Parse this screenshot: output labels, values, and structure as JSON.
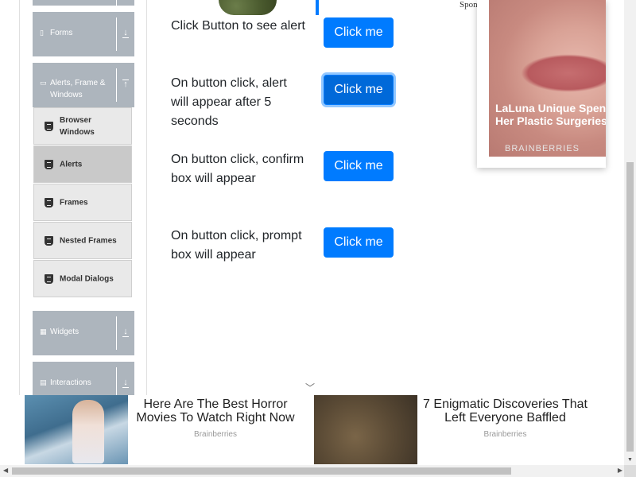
{
  "sidebar": {
    "groups": [
      {
        "label": "Forms",
        "icon": "form-icon",
        "arrow": "expand"
      },
      {
        "label": "Alerts, Frame & Windows",
        "icon": "window-icon",
        "arrow": "collapse"
      },
      {
        "label": "Widgets",
        "icon": "widgets-icon",
        "arrow": "expand"
      },
      {
        "label": "Interactions",
        "icon": "interactions-icon",
        "arrow": "expand"
      }
    ],
    "items": [
      {
        "label": "Browser Windows",
        "icon": "html5-icon",
        "active": false
      },
      {
        "label": "Alerts",
        "icon": "html5-icon",
        "active": true
      },
      {
        "label": "Frames",
        "icon": "html5-icon",
        "active": false
      },
      {
        "label": "Nested Frames",
        "icon": "html5-icon",
        "active": false
      },
      {
        "label": "Modal Dialogs",
        "icon": "html5-icon",
        "active": false
      }
    ]
  },
  "main": {
    "rows": [
      {
        "text": "Click Button to see alert",
        "button": "Click me"
      },
      {
        "text": "On button click, alert will appear after 5 seconds",
        "button": "Click me"
      },
      {
        "text": "On button click, confirm box will appear",
        "button": "Click me"
      },
      {
        "text": "On button click, prompt box will appear",
        "button": "Click me"
      }
    ]
  },
  "ad_side": {
    "sponsored": "Spon",
    "title": "LaLuna Unique Spends L Her Plastic Surgeries",
    "title_line1": "LaLuna Unique Spends L",
    "title_line2": "Her Plastic Surgeries",
    "brand": "BRAINBERRIES"
  },
  "ad_bottom": [
    {
      "title_line1": "Here Are The Best Horror",
      "title_line2": "Movies To Watch Right Now",
      "brand": "Brainberries"
    },
    {
      "title_line1": "7 Enigmatic Discoveries That",
      "title_line2": "Left Everyone Baffled",
      "brand": "Brainberries"
    }
  ],
  "colors": {
    "primary": "#007bff",
    "sidebar_group": "#adb5bd",
    "sidebar_item": "#e9e9e9",
    "sidebar_item_active": "#c9c9c9"
  }
}
